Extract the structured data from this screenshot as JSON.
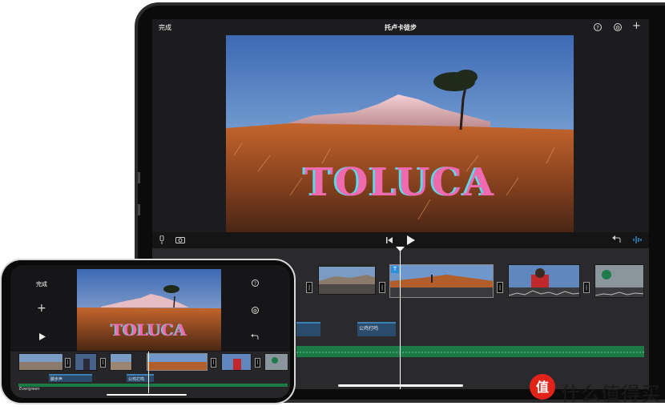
{
  "ipad": {
    "done_label": "完成",
    "title": "托卢卡徒步",
    "help_icon": "question-mark",
    "settings_icon": "gear",
    "add_icon": "plus",
    "preview_title": "TOLUCA",
    "toolbar": {
      "mic_icon": "microphone",
      "camera_icon": "camera",
      "skip_back_icon": "skip-to-start",
      "play_icon": "play",
      "undo_icon": "undo",
      "audio_icon": "waveform"
    },
    "timeline": {
      "title_marker": "T",
      "audio_clip_label": "公鸡打鸣",
      "transition_symbol": "|"
    }
  },
  "iphone": {
    "done_label": "完成",
    "add_icon": "plus",
    "play_icon": "play",
    "help_icon": "question-mark",
    "settings_icon": "gear",
    "undo_icon": "undo",
    "preview_title": "TOLUCA",
    "timeline": {
      "audio_label_1": "脚步声",
      "audio_label_2": "公鸡打鸣",
      "music_label": "Evergreen"
    }
  },
  "watermark": {
    "text": "什么值得买",
    "logo_symbol": "值"
  },
  "colors": {
    "title_pink": "#f06ab0",
    "title_cyan": "#5ad8e6",
    "accent_blue": "#2f8fd8",
    "music_green": "#1d7a46",
    "watermark_red": "#e2231a"
  }
}
